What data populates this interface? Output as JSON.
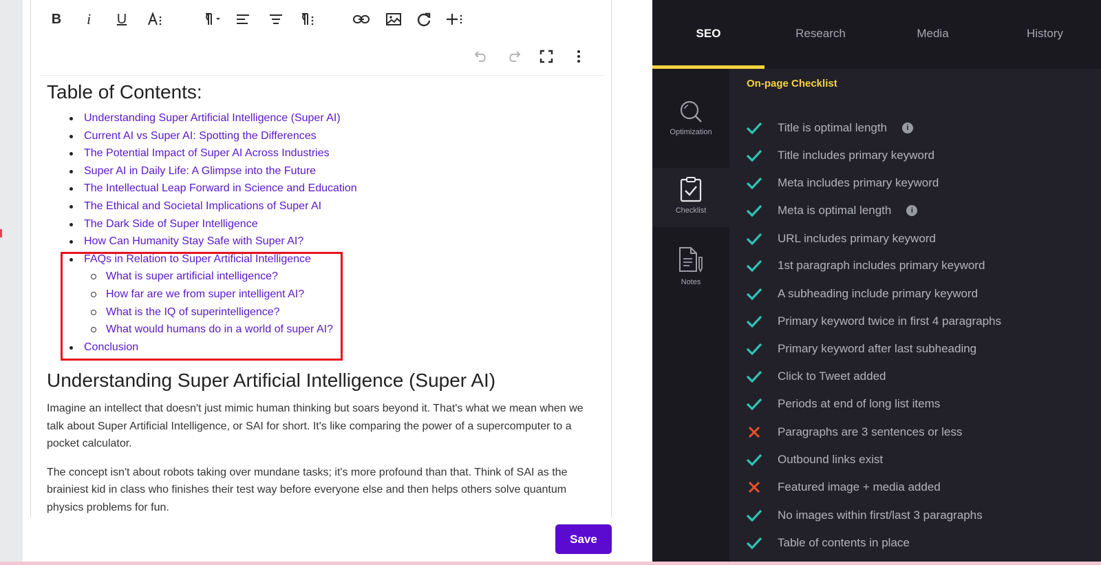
{
  "editor": {
    "toolbar": {
      "bold": "B",
      "italic": "i",
      "underline": "U"
    },
    "toc_title": "Table of Contents:",
    "toc_items": [
      "Understanding Super Artificial Intelligence (Super AI)",
      "Current AI vs Super AI: Spotting the Differences",
      "The Potential Impact of Super AI Across Industries",
      "Super AI in Daily Life: A Glimpse into the Future",
      "The Intellectual Leap Forward in Science and Education",
      "The Ethical and Societal Implications of Super AI",
      "The Dark Side of Super Intelligence",
      "How Can Humanity Stay Safe with Super AI?",
      "FAQs in Relation to Super Artificial Intelligence"
    ],
    "faq_sub_items": [
      "What is super artificial intelligence?",
      "How far are we from super intelligent AI?",
      "What is the IQ of superintelligence?",
      "What would humans do in a world of super AI?"
    ],
    "toc_last": "Conclusion",
    "section_title": "Understanding Super Artificial Intelligence (Super AI)",
    "paragraphs": [
      "Imagine an intellect that doesn't just mimic human thinking but soars beyond it. That's what we mean when we talk about Super Artificial Intelligence, or SAI for short. It's like comparing the power of a supercomputer to a pocket calculator.",
      "The concept isn't about robots taking over mundane tasks; it's more profound than that. Think of SAI as the brainiest kid in class who finishes their test way before everyone else and then helps others solve quantum physics problems for fun."
    ],
    "save_label": "Save"
  },
  "tabs": [
    {
      "label": "SEO",
      "active": true
    },
    {
      "label": "Research",
      "active": false
    },
    {
      "label": "Media",
      "active": false
    },
    {
      "label": "History",
      "active": false
    }
  ],
  "rail": [
    {
      "label": "Optimization",
      "icon": "magnifier-icon"
    },
    {
      "label": "Checklist",
      "icon": "clipboard-check-icon",
      "active": true
    },
    {
      "label": "Notes",
      "icon": "note-pen-icon"
    }
  ],
  "checklist": {
    "title": "On-page Checklist",
    "items": [
      {
        "label": "Title is optimal length",
        "status": "pass",
        "info": true
      },
      {
        "label": "Title includes primary keyword",
        "status": "pass",
        "info": false
      },
      {
        "label": "Meta includes primary keyword",
        "status": "pass",
        "info": false
      },
      {
        "label": "Meta is optimal length",
        "status": "pass",
        "info": true
      },
      {
        "label": "URL includes primary keyword",
        "status": "pass",
        "info": false
      },
      {
        "label": "1st paragraph includes primary keyword",
        "status": "pass",
        "info": false
      },
      {
        "label": "A subheading include primary keyword",
        "status": "pass",
        "info": false
      },
      {
        "label": "Primary keyword twice in first 4 paragraphs",
        "status": "pass",
        "info": false
      },
      {
        "label": "Primary keyword after last subheading",
        "status": "pass",
        "info": false
      },
      {
        "label": "Click to Tweet added",
        "status": "pass",
        "info": false
      },
      {
        "label": "Periods at end of long list items",
        "status": "pass",
        "info": false
      },
      {
        "label": "Paragraphs are 3 sentences or less",
        "status": "fail",
        "info": false
      },
      {
        "label": "Outbound links exist",
        "status": "pass",
        "info": false
      },
      {
        "label": "Featured image + media added",
        "status": "fail",
        "info": false
      },
      {
        "label": "No images within first/last 3 paragraphs",
        "status": "pass",
        "info": false
      },
      {
        "label": "Table of contents in place",
        "status": "pass",
        "info": false
      }
    ]
  },
  "colors": {
    "accent_yellow": "#f5d33f",
    "pass_teal": "#2ec4b6",
    "fail_red": "#e8502a",
    "link_purple": "#5a18c8",
    "save_purple": "#5b0bd0"
  }
}
